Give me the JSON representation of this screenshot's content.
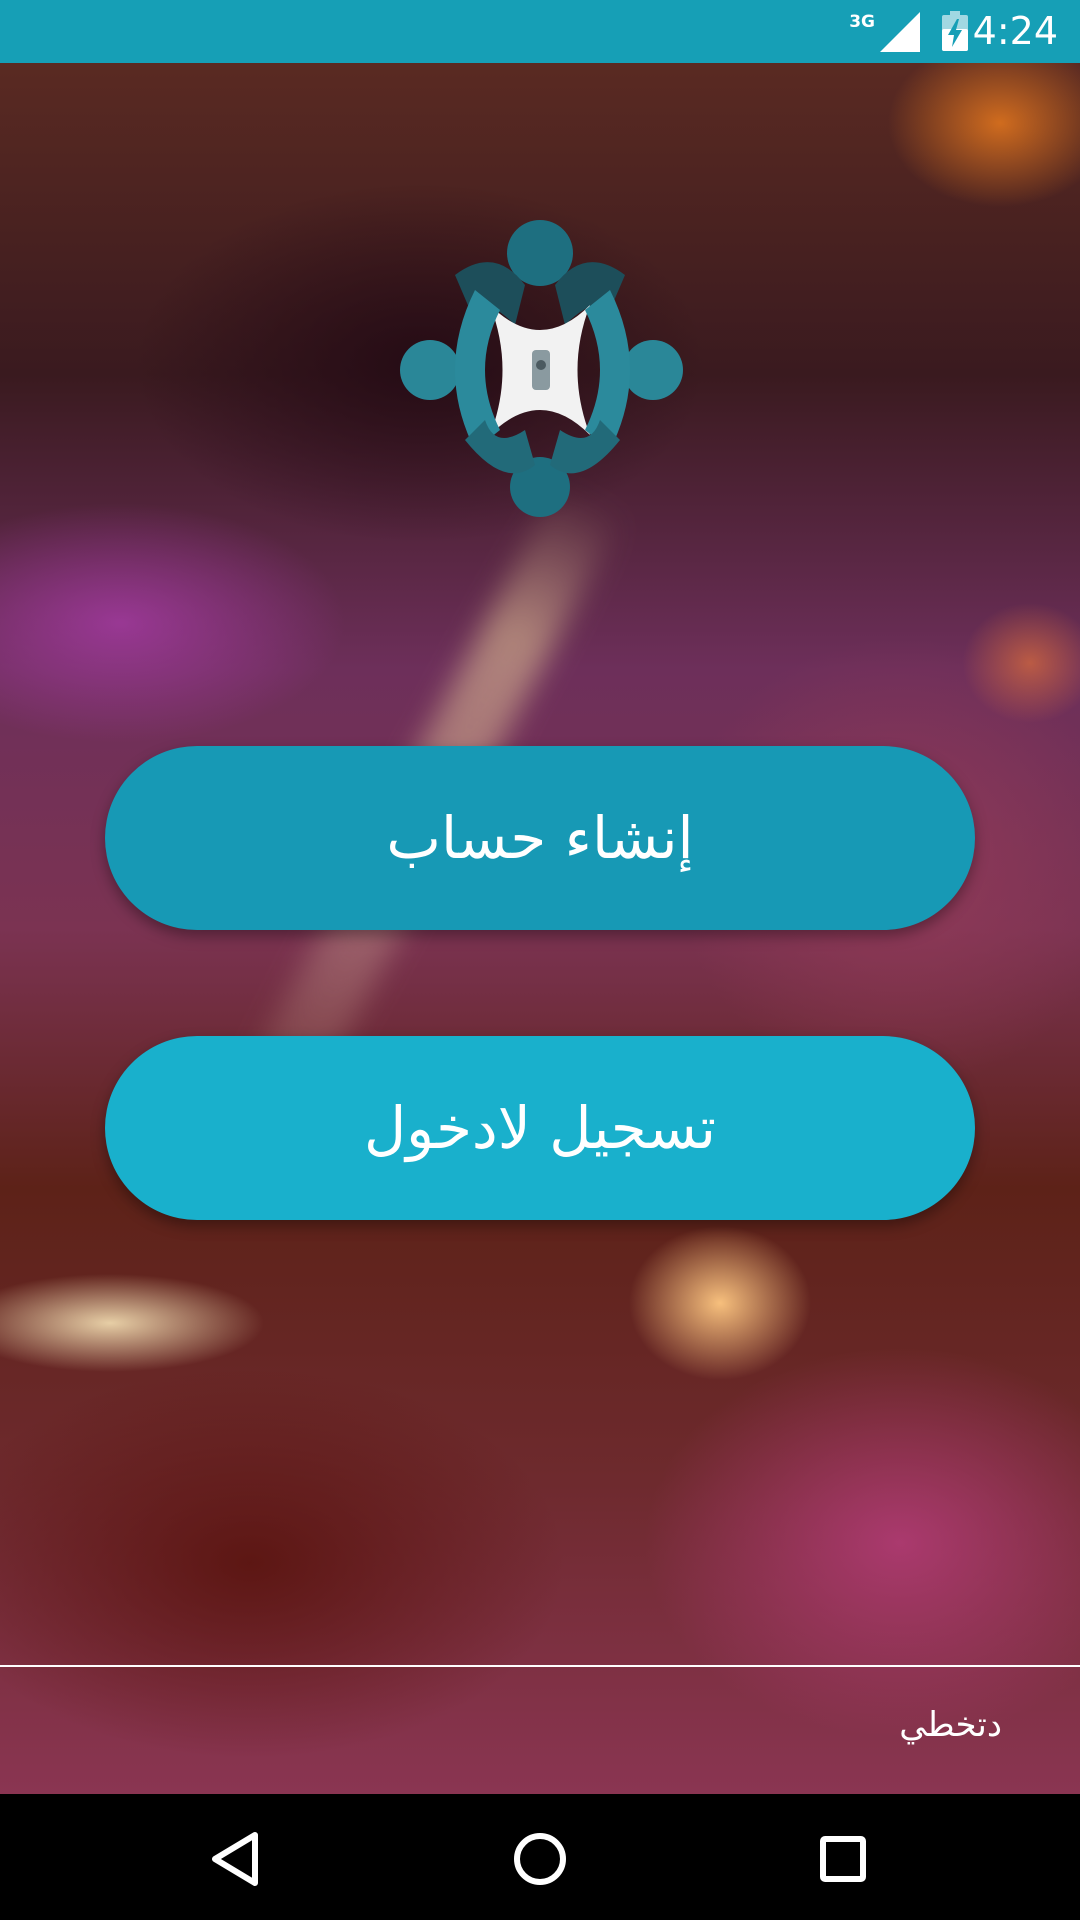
{
  "status_bar": {
    "network": "3G",
    "time": "4:24"
  },
  "buttons": {
    "create_account": "إنشاء حساب",
    "login": "تسجيل لادخول"
  },
  "skip": {
    "label": "دتخطي"
  },
  "navigation": {
    "back_icon": "back-triangle-icon",
    "home_icon": "home-circle-icon",
    "recents_icon": "recents-square-icon"
  },
  "colors": {
    "status_bar": "#169fb6",
    "create_account_button": "#1799b5",
    "login_button": "#19b0cc",
    "nav_bar": "#000000"
  }
}
